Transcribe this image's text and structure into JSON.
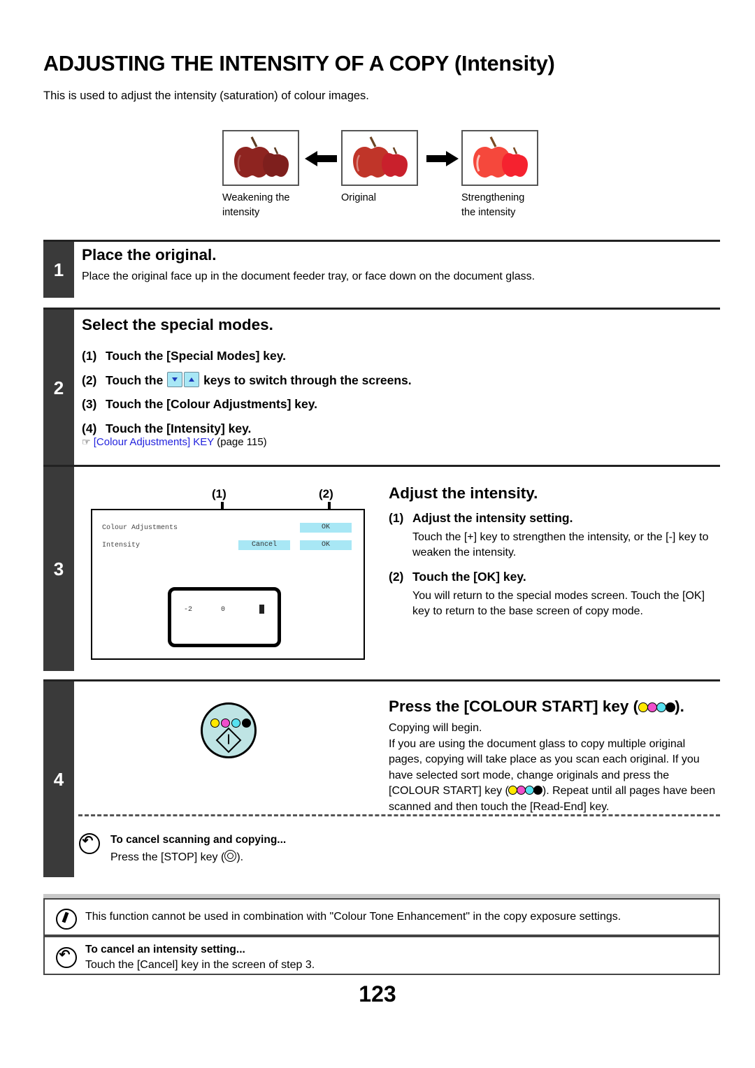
{
  "title": "ADJUSTING THE INTENSITY OF A COPY (Intensity)",
  "intro": "This is used to adjust the intensity (saturation) of colour images.",
  "comparison": {
    "left": {
      "caption_line1": "Weakening the",
      "caption_line2": "intensity"
    },
    "middle": {
      "caption_line1": "Original",
      "caption_line2": ""
    },
    "right": {
      "caption_line1": "Strengthening",
      "caption_line2": "the intensity"
    }
  },
  "steps": [
    {
      "number": "1",
      "heading": "Place the original.",
      "body": "Place the original face up in the document feeder tray, or face down on the document glass."
    },
    {
      "number": "2",
      "heading": "Select the special modes.",
      "items": [
        {
          "num": "(1)",
          "text_before": "Touch the [Special Modes] key.",
          "text_after": ""
        },
        {
          "num": "(2)",
          "text_before": "Touch the",
          "text_after": "keys to switch through the screens."
        },
        {
          "num": "(3)",
          "text_before": "Touch the [Colour Adjustments] key.",
          "text_after": ""
        },
        {
          "num": "(4)",
          "text_before": "Touch the [Intensity] key.",
          "text_after": ""
        }
      ],
      "reference_link": "[Colour Adjustments] KEY",
      "reference_page": "(page 115)"
    },
    {
      "number": "3",
      "heading": "Adjust the intensity.",
      "items": [
        {
          "num": "(1)",
          "title": "Adjust the intensity setting.",
          "body": "Touch the [+] key to strengthen the intensity, or the [-] key to weaken the intensity."
        },
        {
          "num": "(2)",
          "title": "Touch the [OK] key.",
          "body": "You will return to the special modes screen. Touch the [OK] key to return to the base screen of copy mode."
        }
      ]
    },
    {
      "number": "4",
      "heading_before": "Press the [COLOUR START] key (",
      "heading_after": ").",
      "body_line1": "Copying will begin.",
      "body_part1": "If you are using the document glass to copy multiple original pages, copying will take place as you scan each original. If you have selected sort mode, change originals and press the [COLOUR START] key (",
      "body_part2": "). Repeat until all pages have been scanned and then touch the [Read-End] key.",
      "cancel_note": {
        "title": "To cancel scanning and copying...",
        "text_before": "Press the [STOP] key (",
        "text_after": ")."
      }
    }
  ],
  "lcd_screen": {
    "callout_1": "(1)",
    "callout_2": "(2)",
    "row1_label": "Colour Adjustments",
    "row1_ok": "OK",
    "row2_label": "Intensity",
    "row2_cancel": "Cancel",
    "row2_ok": "OK",
    "value_min": "-2",
    "value_current": "0"
  },
  "notes": [
    {
      "icon": "note-pencil-icon",
      "text": "This function cannot be used in combination with \"Colour Tone Enhancement\" in the copy exposure settings."
    },
    {
      "icon": "cancel-arrow-icon",
      "title": "To cancel an intensity setting...",
      "text": "Touch the [Cancel] key in the screen of step 3."
    }
  ],
  "page_number": "123",
  "colors": {
    "cmyk_yellow": "#ffe800",
    "cmyk_magenta": "#ef4ecb",
    "cmyk_cyan": "#57e1f0",
    "cmyk_black": "#000000",
    "lcd_button": "#a8e7f5",
    "step_bar": "#3a3a3a",
    "link": "#2222dd"
  }
}
